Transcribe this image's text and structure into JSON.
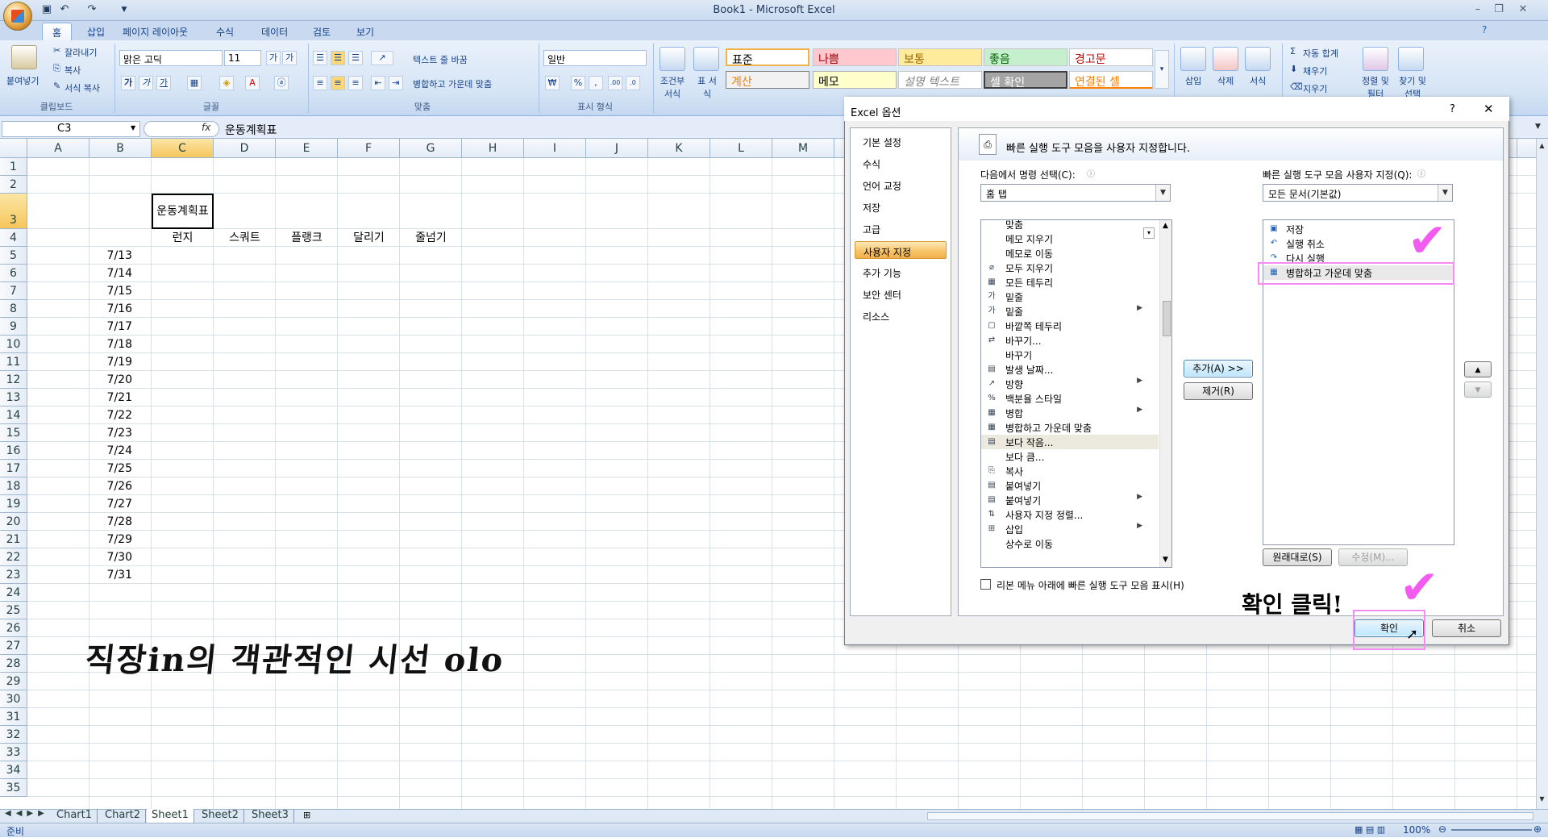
{
  "window": {
    "title": "Book1 - Microsoft Excel"
  },
  "qat": {
    "save": "save-icon",
    "undo": "↶",
    "redo": "↷"
  },
  "tabs": [
    "홈",
    "삽입",
    "페이지 레이아웃",
    "수식",
    "데이터",
    "검토",
    "보기"
  ],
  "ribbon": {
    "clipboard": {
      "paste": "붙여넣기",
      "cut": "잘라내기",
      "copy": "복사",
      "format_painter": "서식 복사",
      "label": "클립보드"
    },
    "font": {
      "name": "맑은 고딕",
      "size": "11",
      "label": "글꼴",
      "bold": "가",
      "italic": "가",
      "underline": "가",
      "grow": "가",
      "shrink": "가"
    },
    "align": {
      "wrap": "텍스트 줄 바꿈",
      "merge": "병합하고 가운데 맞춤",
      "label": "맞춤"
    },
    "number": {
      "format": "일반",
      "currency": "₩",
      "percent": "%",
      "comma": ",",
      "label": "표시 형식"
    },
    "styles": {
      "cond": "조건부 서식",
      "table": "표 서식",
      "normal": "표준",
      "bad": "나쁨",
      "neutral": "보통",
      "good": "좋음",
      "warning": "경고문",
      "calc": "계산",
      "memo": "메모",
      "explain": "설명 텍스트",
      "check": "셀 확인",
      "linked": "연결된 셀"
    },
    "cells": {
      "insert": "삽입",
      "delete": "삭제",
      "format": "서식"
    },
    "editing": {
      "autosum": "자동 합계",
      "fill": "채우기",
      "clear": "지우기",
      "sort": "정렬 및 필터",
      "find": "찾기 및 선택"
    }
  },
  "formula_bar": {
    "name_box": "C3",
    "fx": "fx",
    "value": "운동계획표"
  },
  "columns": [
    "A",
    "B",
    "C",
    "D",
    "E",
    "F",
    "G",
    "H",
    "I",
    "J",
    "K",
    "L",
    "M"
  ],
  "rows": [
    "1",
    "2",
    "3",
    "4",
    "5",
    "6",
    "7",
    "8",
    "9",
    "10",
    "11",
    "12",
    "13",
    "14",
    "15",
    "16",
    "17",
    "18",
    "19",
    "20",
    "21",
    "22",
    "23",
    "24",
    "25",
    "26",
    "27",
    "28",
    "29",
    "30",
    "31",
    "32",
    "33",
    "34",
    "35"
  ],
  "cells": {
    "title": "운동계획표",
    "headers": [
      "런지",
      "스쿼트",
      "플랭크",
      "달리기",
      "줄넘기"
    ],
    "dates": [
      "7/13",
      "7/14",
      "7/15",
      "7/16",
      "7/17",
      "7/18",
      "7/19",
      "7/20",
      "7/21",
      "7/22",
      "7/23",
      "7/24",
      "7/25",
      "7/26",
      "7/27",
      "7/28",
      "7/29",
      "7/30",
      "7/31"
    ]
  },
  "handwriting": "직장in의 객관적인 시선 olo",
  "sheets": [
    "Chart1",
    "Chart2",
    "Sheet1",
    "Sheet2",
    "Sheet3"
  ],
  "status": {
    "ready": "준비",
    "zoom": "100%"
  },
  "dialog": {
    "title": "Excel 옵션",
    "help": "?",
    "close": "✕",
    "nav": [
      "기본 설정",
      "수식",
      "언어 교정",
      "저장",
      "고급",
      "사용자 지정",
      "추가 기능",
      "보안 센터",
      "리소스"
    ],
    "header": "빠른 실행 도구 모음을 사용자 지정합니다.",
    "choose_label": "다음에서 명령 선택(C):",
    "choose_value": "홈 탭",
    "customize_label": "빠른 실행 도구 모음 사용자 지정(Q):",
    "customize_value": "모든 문서(기본값)",
    "commands": [
      "맞춤",
      "메모 지우기",
      "메모로 이동",
      "모두 지우기",
      "모든 테두리",
      "밑줄",
      "밑줄",
      "바깥쪽 테두리",
      "바꾸기...",
      "바꾸기",
      "발생 날짜...",
      "방향",
      "백분율 스타일",
      "병합",
      "병합하고 가운데 맞춤",
      "보다 작음...",
      "보다 큼...",
      "복사",
      "붙여넣기",
      "붙여넣기",
      "사용자 지정 정렬...",
      "삽입",
      "상수로 이동"
    ],
    "qat_items": [
      "저장",
      "실행 취소",
      "다시 실행",
      "병합하고 가운데 맞춤"
    ],
    "add": "추가(A) >>",
    "remove": "제거(R)",
    "reset": "원래대로(S)",
    "modify": "수정(M)...",
    "show_below": "리본 메뉴 아래에 빠른 실행 도구 모음 표시(H)",
    "ok": "확인",
    "cancel": "취소",
    "annotation": "확인 클릭!"
  }
}
